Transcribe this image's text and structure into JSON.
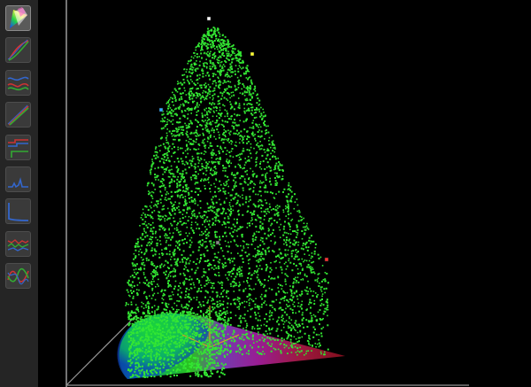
{
  "app": {
    "accent_point_color": "#33e633",
    "background": "#000000"
  },
  "sidebar": {
    "tools": [
      {
        "name": "tool-gamut-3d",
        "icon": "gamut-chart-icon",
        "active": true
      },
      {
        "name": "tool-tone-curve",
        "icon": "tone-curve-icon",
        "active": false
      },
      {
        "name": "tool-rgb-curves-flat",
        "icon": "rgb-curves-flat-icon",
        "active": false
      },
      {
        "name": "tool-rgb-linear",
        "icon": "rgb-linear-curves-icon",
        "active": false
      },
      {
        "name": "tool-rgb-step",
        "icon": "rgb-step-curves-icon",
        "active": false
      },
      {
        "name": "tool-blue-histogram",
        "icon": "blue-histogram-icon",
        "active": false
      },
      {
        "name": "tool-blue-curve",
        "icon": "blue-curve-icon",
        "active": false
      },
      {
        "name": "tool-rgb-noise",
        "icon": "rgb-noise-curves-icon",
        "active": false
      },
      {
        "name": "tool-rgb-wave",
        "icon": "rgb-wave-curves-icon",
        "active": false
      }
    ]
  },
  "viewport": {
    "view": "3d-gamut",
    "point_cloud_color": "#33e633",
    "primary_markers": [
      {
        "name": "white-point-marker",
        "color": "#ffffff"
      },
      {
        "name": "yellow-point-marker",
        "color": "#ffff33"
      },
      {
        "name": "cyan-point-marker",
        "color": "#33aaff"
      },
      {
        "name": "red-point-marker",
        "color": "#ff3333"
      },
      {
        "name": "gray-point-marker",
        "color": "#888888"
      }
    ],
    "axes_color": "#bbbbbb"
  }
}
